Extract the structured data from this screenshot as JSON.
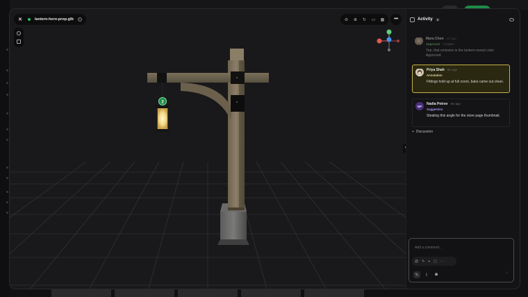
{
  "viewer": {
    "close_label": "✕",
    "filename": "lantern-hero-prop.glb",
    "toolbar": [
      "zoom-out",
      "zoom-in",
      "reset-view",
      "wireframe",
      "grid"
    ],
    "more_label": "•••",
    "collapse_label": "›"
  },
  "activity": {
    "title": "Activity",
    "count": "3",
    "comments": [
      {
        "author": "Mara Chen",
        "time": "4m ago",
        "tag": "Approved",
        "tag_extra": "2 replies",
        "body": "Yep, that emissive is the lantern-reveal color. Approved."
      },
      {
        "author": "Priya Shah",
        "time": "6m ago",
        "tag": "Annotation",
        "body": "Fittings hold up at full zoom, bake came out clean."
      },
      {
        "author": "Nadia Petrov",
        "initials": "NP",
        "time": "8m ago",
        "tag": "Suggestion",
        "body": "Stealing this angle for the store page thumbnail."
      }
    ],
    "discussion_label": "Discussion",
    "composer_placeholder": "Add a comment..."
  },
  "colors": {
    "accent_green": "#22c55e",
    "highlight_border": "#c8b34a",
    "suggestion_purple": "#a88ee8"
  }
}
